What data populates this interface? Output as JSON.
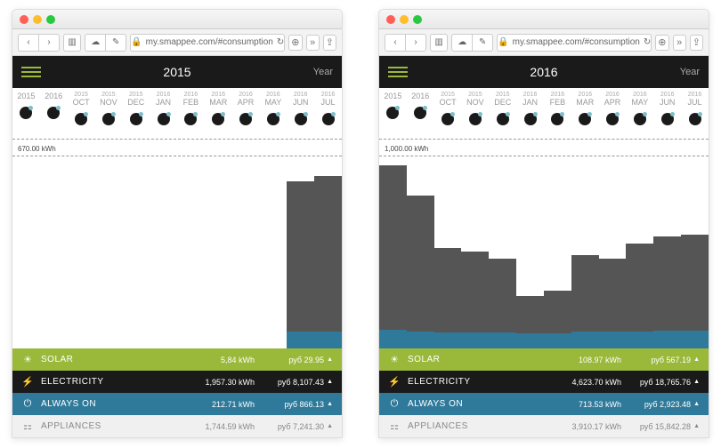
{
  "url": "my.smappee.com/#consumption",
  "period_label": "Year",
  "panels": [
    {
      "year": "2015",
      "axis_label": "670.00 kWh",
      "months": [
        {
          "top": "",
          "lbl": "2015"
        },
        {
          "top": "",
          "lbl": "2016"
        },
        {
          "top": "2015",
          "lbl": "OCT"
        },
        {
          "top": "2015",
          "lbl": "NOV"
        },
        {
          "top": "2015",
          "lbl": "DEC"
        },
        {
          "top": "2016",
          "lbl": "JAN"
        },
        {
          "top": "2016",
          "lbl": "FEB"
        },
        {
          "top": "2016",
          "lbl": "MAR"
        },
        {
          "top": "2016",
          "lbl": "APR"
        },
        {
          "top": "2016",
          "lbl": "MAY"
        },
        {
          "top": "2016",
          "lbl": "JUN"
        },
        {
          "top": "2016",
          "lbl": "JUL"
        }
      ],
      "rows": {
        "solar": {
          "label": "SOLAR",
          "kwh": "5,84 kWh",
          "cost": "руб 29.95",
          "up": true
        },
        "elec": {
          "label": "ELECTRICITY",
          "kwh": "1,957.30 kWh",
          "cost": "руб 8,107.43",
          "up": true
        },
        "always": {
          "label": "ALWAYS ON",
          "kwh": "212.71 kWh",
          "cost": "руб 866.13",
          "up": true
        },
        "appl": {
          "label": "APPLIANCES",
          "kwh": "1,744.59 kWh",
          "cost": "руб 7,241.30",
          "up": true
        }
      }
    },
    {
      "year": "2016",
      "axis_label": "1,000.00 kWh",
      "months": [
        {
          "top": "",
          "lbl": "2015"
        },
        {
          "top": "",
          "lbl": "2016"
        },
        {
          "top": "2015",
          "lbl": "OCT"
        },
        {
          "top": "2015",
          "lbl": "NOV"
        },
        {
          "top": "2015",
          "lbl": "DEC"
        },
        {
          "top": "2016",
          "lbl": "JAN"
        },
        {
          "top": "2016",
          "lbl": "FEB"
        },
        {
          "top": "2016",
          "lbl": "MAR"
        },
        {
          "top": "2016",
          "lbl": "APR"
        },
        {
          "top": "2016",
          "lbl": "MAY"
        },
        {
          "top": "2016",
          "lbl": "JUN"
        },
        {
          "top": "2016",
          "lbl": "JUL"
        }
      ],
      "rows": {
        "solar": {
          "label": "SOLAR",
          "kwh": "108.97 kWh",
          "cost": "руб 567.19",
          "up": true
        },
        "elec": {
          "label": "ELECTRICITY",
          "kwh": "4,623.70 kWh",
          "cost": "руб 18,765.76",
          "up": false
        },
        "always": {
          "label": "ALWAYS ON",
          "kwh": "713.53 kWh",
          "cost": "руб 2,923.48",
          "up": true
        },
        "appl": {
          "label": "APPLIANCES",
          "kwh": "3,910.17 kWh",
          "cost": "руб 15,842.28",
          "up": false
        }
      }
    }
  ],
  "chart_data": [
    {
      "type": "bar",
      "title": "2015 consumption",
      "ylabel": "kWh",
      "ylim": [
        0,
        670
      ],
      "categories": [
        "2015",
        "2016",
        "OCT",
        "NOV",
        "DEC",
        "JAN",
        "FEB",
        "MAR",
        "APR",
        "MAY",
        "JUN",
        "JUL"
      ],
      "series": [
        {
          "name": "Electricity",
          "values": [
            0,
            0,
            0,
            0,
            0,
            0,
            0,
            0,
            0,
            0,
            600,
            620
          ]
        },
        {
          "name": "Always On",
          "values": [
            0,
            0,
            0,
            0,
            0,
            0,
            0,
            0,
            0,
            0,
            60,
            62
          ]
        }
      ]
    },
    {
      "type": "bar",
      "title": "2016 consumption",
      "ylabel": "kWh",
      "ylim": [
        0,
        1000
      ],
      "categories": [
        "2015",
        "2016",
        "OCT",
        "NOV",
        "DEC",
        "JAN",
        "FEB",
        "MAR",
        "APR",
        "MAY",
        "JUN",
        "JUL"
      ],
      "series": [
        {
          "name": "Electricity",
          "values": [
            980,
            820,
            540,
            520,
            480,
            280,
            310,
            500,
            480,
            560,
            600,
            610
          ]
        },
        {
          "name": "Always On",
          "values": [
            98,
            90,
            85,
            85,
            85,
            80,
            82,
            90,
            90,
            92,
            95,
            95
          ]
        }
      ]
    }
  ]
}
